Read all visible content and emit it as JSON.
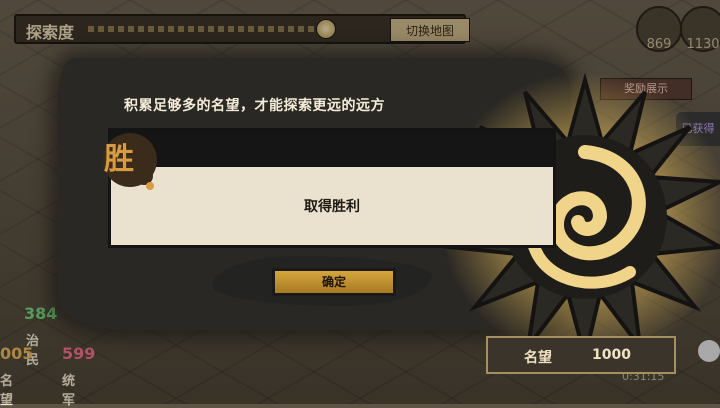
{
  "topbar": {
    "title": "探索度",
    "switch_label": "切换地图"
  },
  "resources": [
    {
      "value": "869"
    },
    {
      "value": "1130"
    }
  ],
  "reward": {
    "label": "奖励展示"
  },
  "side_badge": {
    "label": "已获得"
  },
  "stats": {
    "governance": {
      "value": "384",
      "label": "治民"
    },
    "prestige_left": {
      "value": "005",
      "label": "名望"
    },
    "army": {
      "value": "599",
      "label": "统军"
    }
  },
  "dialog": {
    "hint": "积累足够多的名望，才能探索更远的远方",
    "badge_char": "胜",
    "message": "取得胜利",
    "confirm_label": "确定"
  },
  "prestige": {
    "label": "名望",
    "value": "1000"
  },
  "timer": "0:31:15",
  "colors": {
    "gold": "#d6a63d",
    "ink": "#151515",
    "paper": "#eae2cf",
    "sun": "#f0d48a"
  }
}
